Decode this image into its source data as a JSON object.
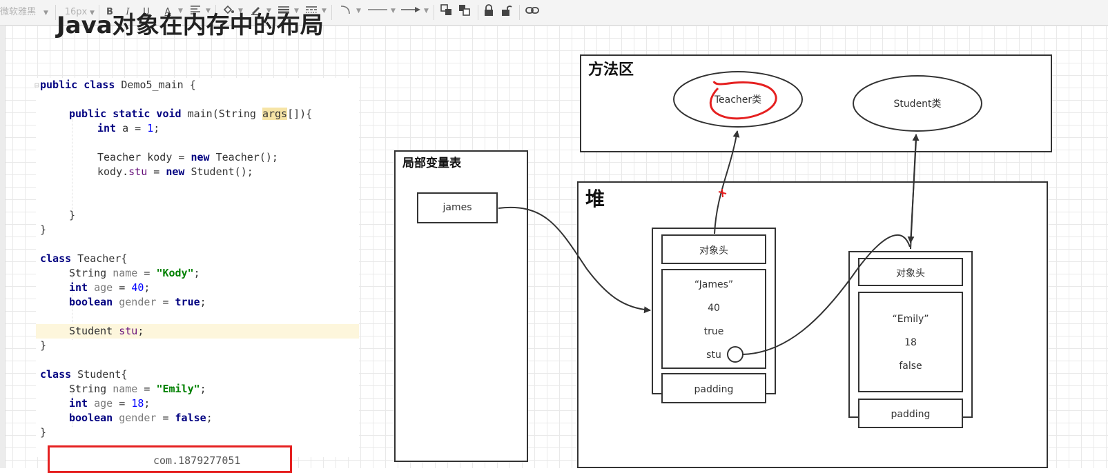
{
  "toolbar": {
    "font_family": "微软雅黑",
    "font_size": "16px",
    "bold": "B",
    "italic": "I",
    "underline": "U",
    "font_color": "A"
  },
  "title": "Java对象在内存中的布局",
  "code": {
    "line1": {
      "kw": "public class",
      "rest": " Demo5_main {"
    },
    "line3": {
      "kw": "public static void",
      "mid": " main(String ",
      "arg": "args",
      "rest": "[]){"
    },
    "line4": {
      "kw": "int",
      "mid": " a = ",
      "num": "1",
      "rest": ";"
    },
    "line6": {
      "pre": "Teacher kody = ",
      "kw": "new",
      "rest": " Teacher();"
    },
    "line7": {
      "pre": "kody.",
      "fld": "stu",
      "mid": " = ",
      "kw": "new",
      "rest": " Student();"
    },
    "line10": "}",
    "line11": "}",
    "line13": {
      "kw": "class",
      "rest": " Teacher{"
    },
    "line14": {
      "pre": "String ",
      "var": "name",
      "mid": " = ",
      "str": "\"Kody\"",
      "rest": ";"
    },
    "line15": {
      "kw": "int",
      "var": " age",
      "mid": " = ",
      "num": "40",
      "rest": ";"
    },
    "line16": {
      "kw": "boolean",
      "var": " gender",
      "mid": " = ",
      "kw2": "true",
      "rest": ";"
    },
    "line18": {
      "pre": "Student ",
      "fld": "stu",
      "rest": ";"
    },
    "line19": "}",
    "line21": {
      "kw": "class",
      "rest": " Student{"
    },
    "line22": {
      "pre": "String ",
      "var": "name",
      "mid": " = ",
      "str": "\"Emily\"",
      "rest": ";"
    },
    "line23": {
      "kw": "int",
      "var": " age",
      "mid": " = ",
      "num": "18",
      "rest": ";"
    },
    "line24": {
      "kw": "boolean",
      "var": " gender",
      "mid": " = ",
      "kw2": "false",
      "rest": ";"
    },
    "line25": "}"
  },
  "redbox_text": "com.1879277051",
  "diagram": {
    "method_area": {
      "label": "方法区",
      "teacher_class": "Teacher类",
      "student_class": "Student类"
    },
    "local_vars": {
      "label": "局部变量表",
      "james": "james"
    },
    "heap": {
      "label": "堆"
    },
    "teacher_obj": {
      "header": "对象头",
      "name": "“James”",
      "age": "40",
      "gender": "true",
      "stu": "stu",
      "padding": "padding"
    },
    "student_obj": {
      "header": "对象头",
      "name": "“Emily”",
      "age": "18",
      "gender": "false",
      "padding": "padding"
    }
  },
  "colors": {
    "keyword": "#000080",
    "string": "#008000",
    "number": "#0000ff",
    "field": "#660e7a",
    "highlight": "#e52020"
  }
}
